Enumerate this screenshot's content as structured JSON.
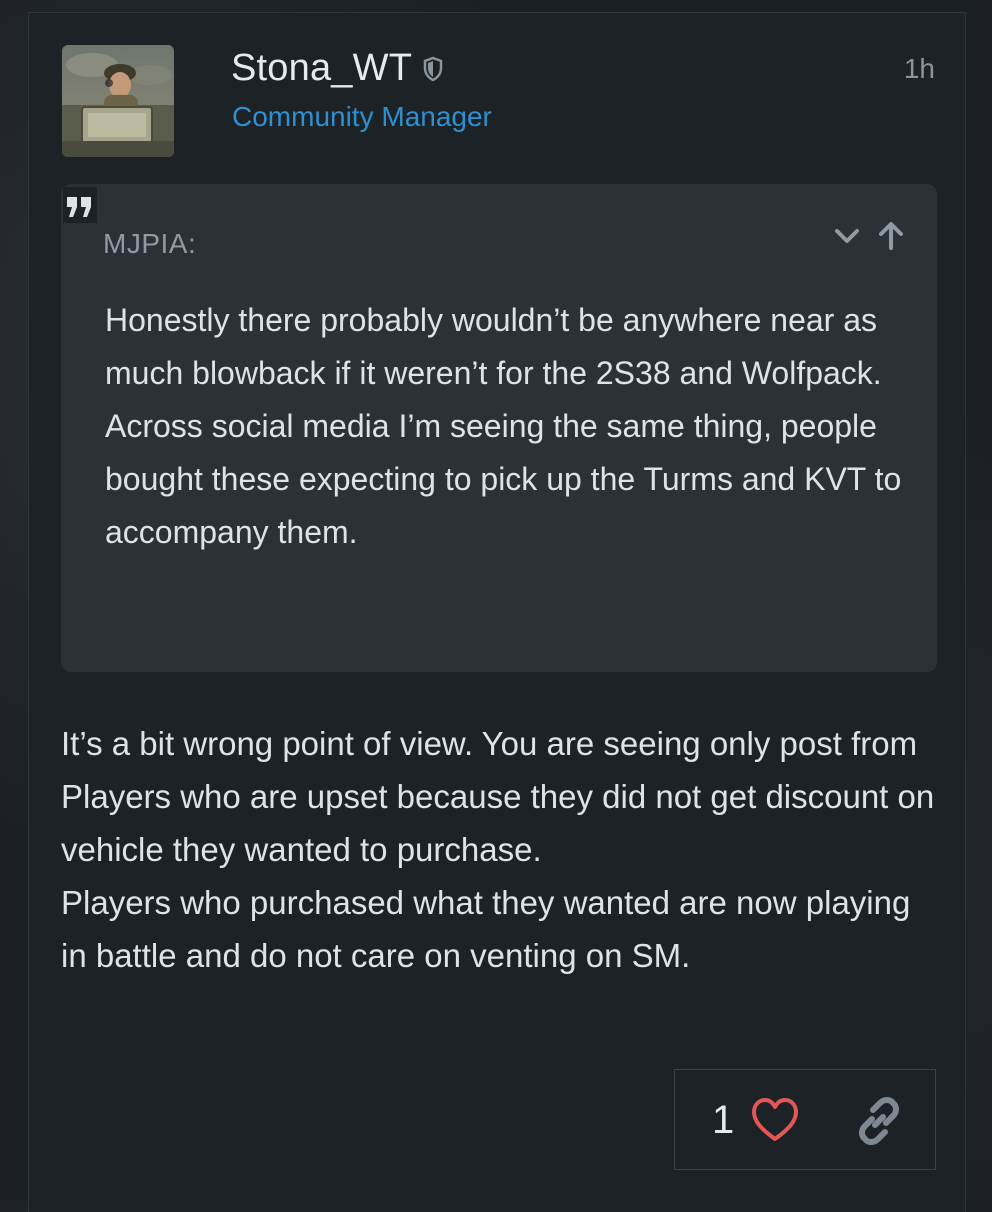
{
  "post": {
    "username": "Stona_WT",
    "user_title": "Community Manager",
    "time": "1h",
    "quote": {
      "author": "MJPIA:",
      "lines": [
        "Honestly there probably wouldn’t be anywhere near as much blowback if it weren’t for the 2S38 and Wolfpack.",
        "Across social media I’m seeing the same thing, people bought these expecting to pick up the Turms and KVT to accompany them."
      ]
    },
    "body": [
      "It’s a bit wrong point of view. You are seeing only post from Players who are upset because they did not get discount on vehicle they wanted to purchase.",
      "Players who purchased what they wanted are now playing in battle and do not care on venting on SM."
    ],
    "likes": "1",
    "icons": {
      "moderator": "shield-icon",
      "quote": "quote-icon",
      "expand": "chevron-down-icon",
      "jump": "arrow-up-icon",
      "like": "heart-icon",
      "link": "link-icon"
    },
    "colors": {
      "accent": "#2e8fd1",
      "like": "#e45757",
      "link_icon": "#7d8892"
    }
  }
}
